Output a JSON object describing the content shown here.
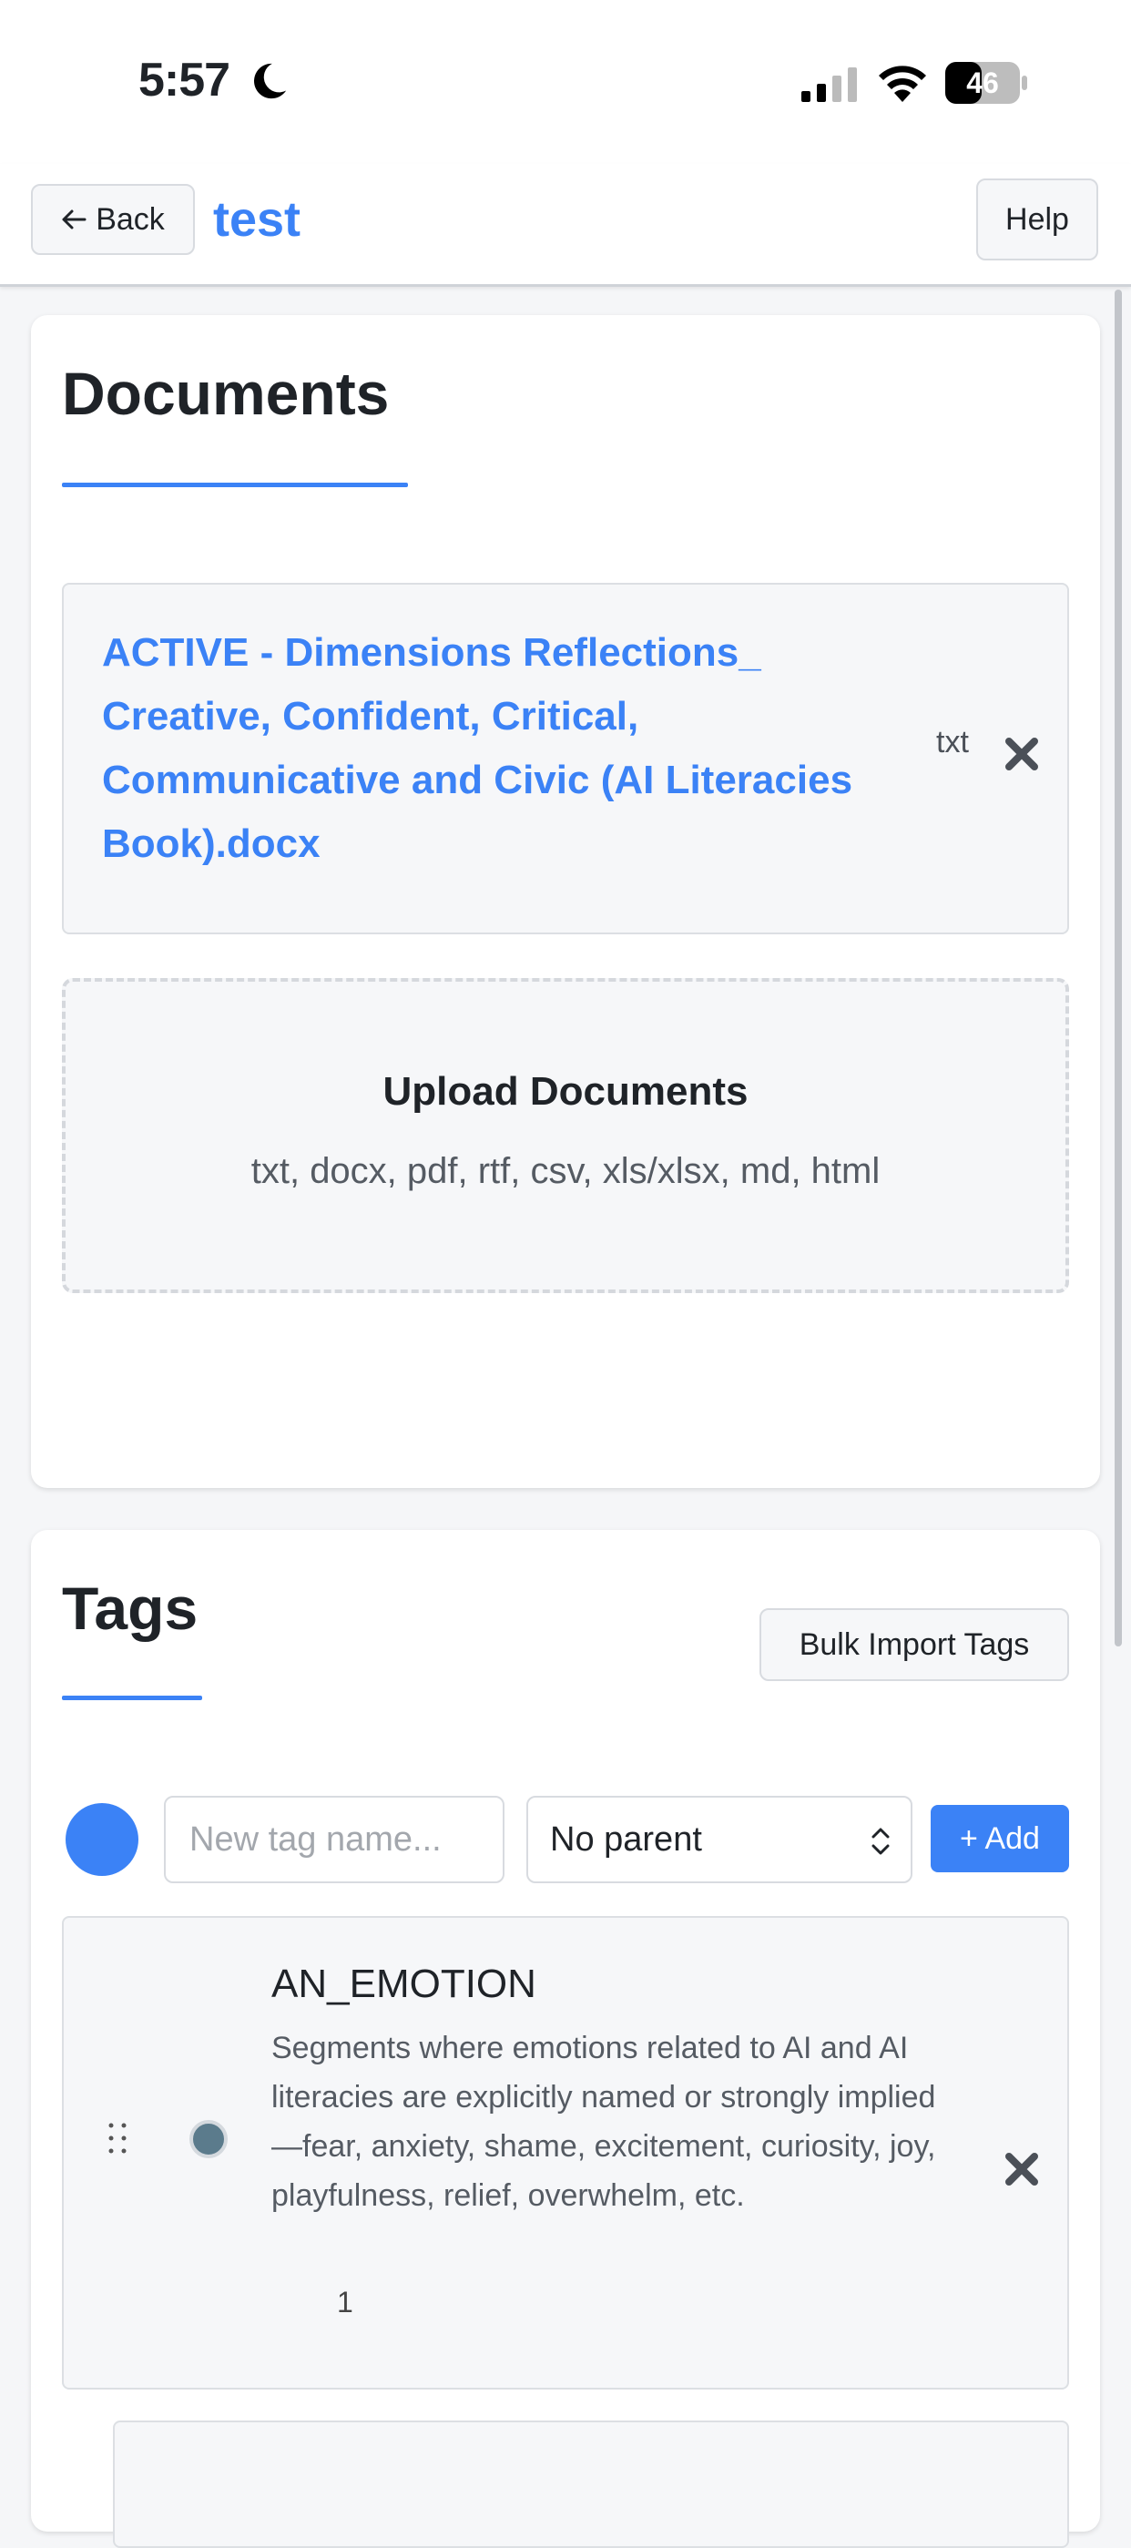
{
  "status_bar": {
    "time": "5:57",
    "battery": "46"
  },
  "header": {
    "back_label": "Back",
    "title": "test",
    "help_label": "Help"
  },
  "documents": {
    "title": "Documents",
    "items": [
      {
        "name": "ACTIVE - Dimensions Reflections_ Creative, Confident, Critical, Communicative and Civic (AI Literacies Book).docx",
        "type": "txt"
      }
    ],
    "upload": {
      "title": "Upload Documents",
      "formats": "txt, docx, pdf, rtf, csv, xls/xlsx, md, html"
    }
  },
  "tags": {
    "title": "Tags",
    "bulk_import_label": "Bulk Import Tags",
    "new_tag": {
      "placeholder": "New tag name...",
      "parent_value": "No parent",
      "add_label": "+ Add",
      "color": "#3b82f6"
    },
    "items": [
      {
        "name": "AN_EMOTION",
        "description": "Segments where emotions related to AI and AI literacies are explicitly named or strongly implied—fear, anxiety, shame, excitement, curiosity, joy, playfulness, relief, overwhelm, etc.",
        "count": "1",
        "color": "#5b7b8c"
      }
    ]
  }
}
